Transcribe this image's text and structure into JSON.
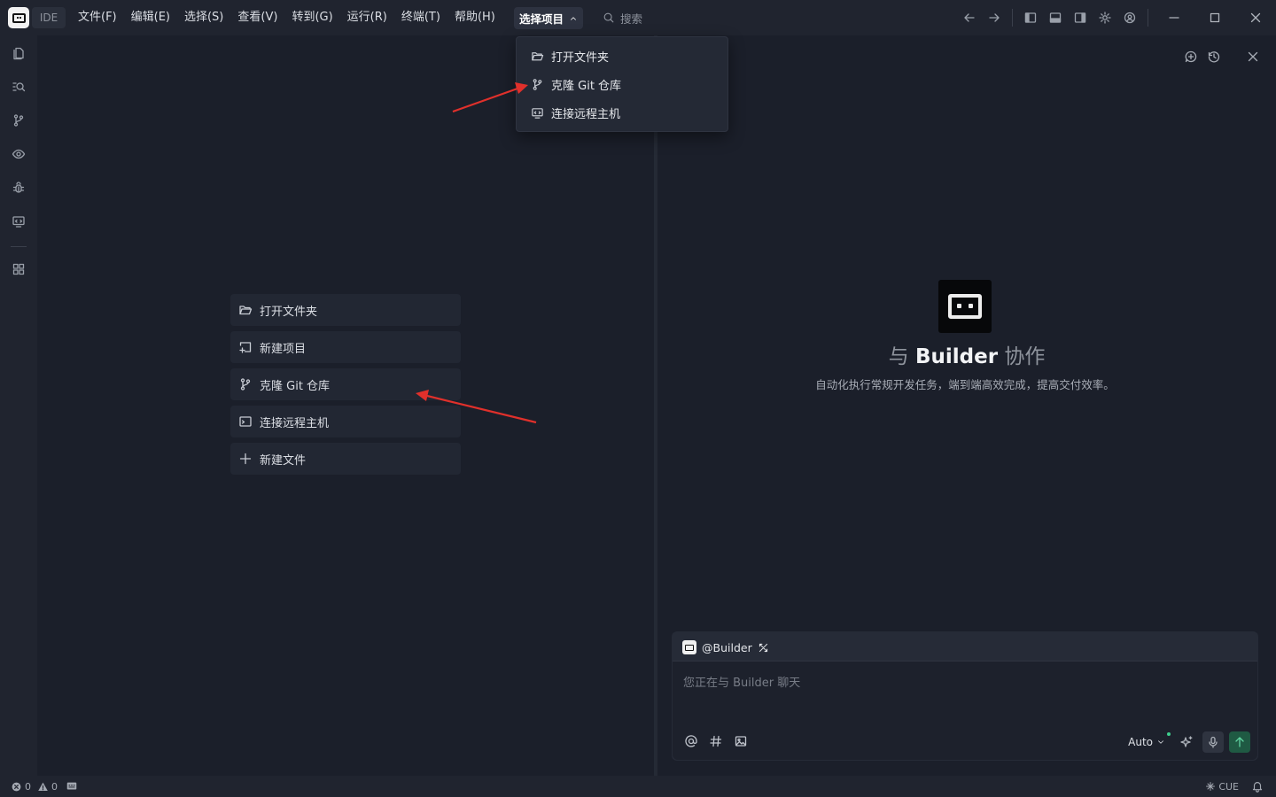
{
  "app": {
    "badge": "IDE",
    "menu": [
      "文件(F)",
      "编辑(E)",
      "选择(S)",
      "查看(V)",
      "转到(G)",
      "运行(R)",
      "终端(T)",
      "帮助(H)"
    ],
    "project_select": "选择项目",
    "search_placeholder": "搜索"
  },
  "dropdown": {
    "items": [
      "打开文件夹",
      "克隆 Git 仓库",
      "连接远程主机"
    ]
  },
  "welcome": {
    "items": [
      "打开文件夹",
      "新建项目",
      "克隆 Git 仓库",
      "连接远程主机",
      "新建文件"
    ]
  },
  "panel": {
    "title_prefix": "与",
    "title_brand": "Builder",
    "title_suffix": "协作",
    "subtitle": "自动化执行常规开发任务，端到端高效完成，提高交付效率。",
    "chat": {
      "agent": "@Builder",
      "placeholder": "您正在与 Builder 聊天",
      "mode": "Auto"
    }
  },
  "status": {
    "errors": "0",
    "warnings": "0",
    "cue": "CUE"
  },
  "colors": {
    "background": "#1b1f2a",
    "chrome": "#20242f",
    "accent_send": "#1f5a43",
    "annotation_arrow": "#e0302b"
  }
}
